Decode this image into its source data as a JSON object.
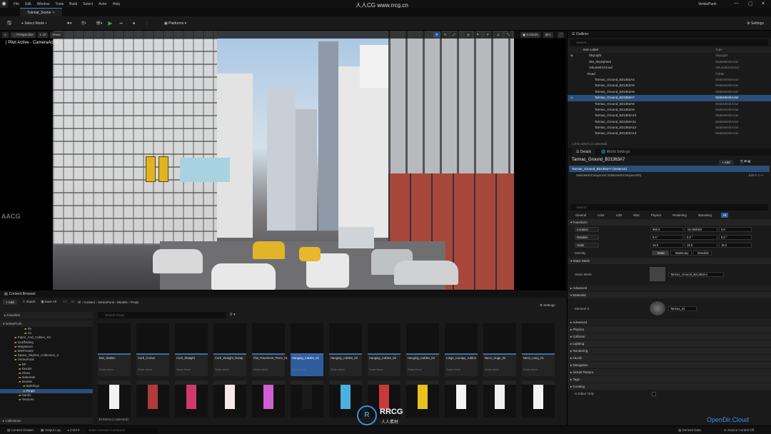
{
  "menubar": {
    "items": [
      "File",
      "Edit",
      "Window",
      "Tools",
      "Build",
      "Select",
      "Actor",
      "Help"
    ],
    "watermark": "人人CG www.rrcg.cn",
    "project": "VertexPunk"
  },
  "tab": {
    "label": "Tutorial_Scene"
  },
  "toolbar": {
    "select_mode": "Select Mode",
    "platforms": "Platforms",
    "settings": "Settings"
  },
  "viewport": {
    "perspective": "Perspective",
    "lit": "Lit",
    "show": "Show",
    "pilot": "| Pilot Active - CameraActor",
    "cam_speed": "0.03125",
    "grid": "4"
  },
  "outliner": {
    "title": "Outliner",
    "search": "Search...",
    "col_label": "Item Label",
    "col_type": "Type",
    "status": "1,072 actors (1 selected)",
    "rows": [
      {
        "n": "SkyLight",
        "t": "SkyLight",
        "sel": false
      },
      {
        "n": "SM_SkySphere",
        "t": "StaticMeshActor",
        "sel": false
      },
      {
        "n": "VolumetricCloud",
        "t": "VolumetricCloud",
        "sel": false
      },
      {
        "n": "Road",
        "t": "Folder",
        "sel": false
      },
      {
        "n": "Tarmac_Ground_B21363A4",
        "t": "StaticMeshActor",
        "sel": false
      },
      {
        "n": "Tarmac_Ground_B21363A5",
        "t": "StaticMeshActor",
        "sel": false
      },
      {
        "n": "Tarmac_Ground_B21363A6",
        "t": "StaticMeshActor",
        "sel": false
      },
      {
        "n": "Tarmac_Ground_B21363A7",
        "t": "StaticMeshActor",
        "sel": true
      },
      {
        "n": "Tarmac_Ground_B21363A8",
        "t": "StaticMeshActor",
        "sel": false
      },
      {
        "n": "Tarmac_Ground_B21363A9",
        "t": "StaticMeshActor",
        "sel": false
      },
      {
        "n": "Tarmac_Ground_B21363A10",
        "t": "StaticMeshActor",
        "sel": false
      },
      {
        "n": "Tarmac_Ground_B21363A11",
        "t": "StaticMeshActor",
        "sel": false
      },
      {
        "n": "Tarmac_Ground_B21363A12",
        "t": "StaticMeshActor",
        "sel": false
      },
      {
        "n": "Tarmac_Ground_B21363A13",
        "t": "StaticMeshActor",
        "sel": false
      }
    ]
  },
  "details": {
    "tab1": "Details",
    "tab2": "World Settings",
    "actor": "Tarmac_Ground_B21363A7",
    "add": "+ Add",
    "instance": "Tarmac_Ground_B21363A7 (Instance)",
    "component": "StaticMeshComponent (StaticMeshComponent0)",
    "edit_cpp": "Edit in C++",
    "search": "Search",
    "filters": [
      "General",
      "Actor",
      "LOD",
      "Misc",
      "Physics",
      "Rendering",
      "Streaming",
      "All"
    ],
    "transform": "Transform",
    "location": "Location",
    "rotation": "Rotation",
    "scale": "Scale",
    "mobility": "Mobility",
    "loc": [
      "900.0",
      "-91.060002",
      "0.0"
    ],
    "rot": [
      "0.0 °",
      "0.0 °",
      "0.0 °"
    ],
    "scl": [
      "15.0",
      "15.0",
      "15.0"
    ],
    "mob": [
      "Static",
      "Stationary",
      "Movable"
    ],
    "static_mesh_sect": "Static Mesh",
    "static_mesh": "Static Mesh",
    "mesh_val": "Tarmac_Ground_B21363A4",
    "advanced": "Advanced",
    "materials": "Materials",
    "element0": "Element 0",
    "mat_val": "Tarmac_01",
    "sections": [
      "Advanced",
      "Physics",
      "Collision",
      "Lighting",
      "Rendering",
      "HLOD",
      "Navigation",
      "Virtual Texture",
      "Tags",
      "Cooking"
    ],
    "editor_only": "Is Editor Only"
  },
  "content_browser": {
    "title": "Content Browser",
    "add": "+ Add",
    "import": "Import",
    "save_all": "Save All",
    "settings": "Settings",
    "search": "Search Props",
    "status": "40 items (1 selected)",
    "path": [
      "All",
      "Content",
      "VertexPunk",
      "Models",
      "Props"
    ],
    "favorites": "Favorites",
    "root": "VertexPunk",
    "collections": "Collections",
    "tree": [
      "09",
      "10",
      "Pipes_And_Cables_Kit",
      "Scaffolding",
      "Megastore",
      "MSPresets",
      "Space_Skybox_Collection_2",
      "VertexPunk",
      "BP",
      "Decals",
      "Glass",
      "Materials",
      "Models",
      "Buildings",
      "Props",
      "Sands",
      "Textures"
    ],
    "tiles": [
      {
        "n": "Bus_Station",
        "s": "Static Mesh",
        "sel": false
      },
      {
        "n": "Curb_Corner",
        "s": "Static Mesh",
        "sel": false
      },
      {
        "n": "Curb_Straight",
        "s": "Static Mesh",
        "sel": false
      },
      {
        "n": "Curb_Straight_Ramp",
        "s": "Static Mesh",
        "sel": false
      },
      {
        "n": "Flat_Pavement_Piece_01",
        "s": "Static Mesh",
        "sel": false
      },
      {
        "n": "Hanging_Cables_01",
        "s": "Static Mesh",
        "sel": true
      },
      {
        "n": "Hanging_Cables_02",
        "s": "Static Mesh",
        "sel": false
      },
      {
        "n": "Hanging_Cables_03",
        "s": "Static Mesh",
        "sel": false
      },
      {
        "n": "Hanging_Cables_04",
        "s": "Static Mesh",
        "sel": false
      },
      {
        "n": "Large_Canopy_Addon",
        "s": "Static Mesh",
        "sel": false
      },
      {
        "n": "Neon_Huge_02",
        "s": "Static Mesh",
        "sel": false
      },
      {
        "n": "Neon_Long_01",
        "s": "Static Mesh",
        "sel": false
      }
    ]
  },
  "statusbar": {
    "content_drawer": "Content Drawer",
    "output_log": "Output Log",
    "cmd": "Cmd",
    "console": "Enter Console Command",
    "derived": "Derived Data",
    "source": "Source Control Off"
  },
  "overlay": {
    "opendir": "OpenDir.Cloud",
    "rrcg": "RRCG",
    "rrcg_sub": "人人素材",
    "aacg": "AACG"
  },
  "colors": {
    "accent": "#2a4f7a",
    "selected_tile": "#2d5d9c",
    "play": "#3aa03a"
  }
}
